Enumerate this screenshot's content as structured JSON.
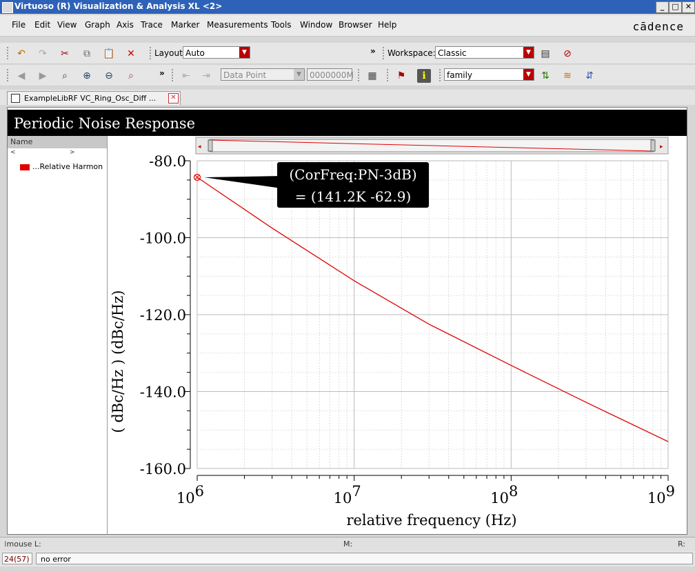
{
  "window": {
    "title": "Virtuoso (R) Visualization & Analysis XL <2>"
  },
  "menubar": {
    "items": [
      "File",
      "Edit",
      "View",
      "Graph",
      "Axis",
      "Trace",
      "Marker",
      "Measurements",
      "Tools",
      "Window",
      "Browser",
      "Help"
    ],
    "brand": "cādence"
  },
  "toolbar1": {
    "layout_label": "Layout:",
    "layout_value": "Auto",
    "workspace_label": "Workspace:",
    "workspace_value": "Classic",
    "overflow": "»"
  },
  "toolbar2": {
    "overflow": "»",
    "marker_type": "Data Point",
    "marker_value": "0000000M",
    "family_value": "family"
  },
  "tab": {
    "label": "ExampleLibRF VC_Ring_Osc_Diff ..."
  },
  "graph": {
    "title": "Periodic Noise Response"
  },
  "browser": {
    "header": "Name",
    "scroll_left": "<",
    "scroll_right": ">",
    "trace_label": "...Relative Harmon"
  },
  "marker": {
    "line1": "(CorFreq:PN-3dB)",
    "line2": "= (141.2K -62.9)"
  },
  "chart_data": {
    "type": "line",
    "xlabel": "relative frequency (Hz)",
    "ylabel": "( dBc/Hz ) (dBc/Hz)",
    "x_scale": "log",
    "xlim": [
      1000000,
      1000000000
    ],
    "ylim": [
      -160,
      -80
    ],
    "x_ticks": [
      {
        "value": 1000000,
        "base": "10",
        "exp": "6"
      },
      {
        "value": 10000000,
        "base": "10",
        "exp": "7"
      },
      {
        "value": 100000000,
        "base": "10",
        "exp": "8"
      },
      {
        "value": 1000000000,
        "base": "10",
        "exp": "9"
      }
    ],
    "y_ticks": [
      {
        "value": -80,
        "label": "-80.0"
      },
      {
        "value": -100,
        "label": "-100.0"
      },
      {
        "value": -120,
        "label": "-120.0"
      },
      {
        "value": -140,
        "label": "-140.0"
      },
      {
        "value": -160,
        "label": "-160.0"
      }
    ],
    "grid": true,
    "series": [
      {
        "color": "#e00000",
        "x": [
          1000000,
          3000000,
          10000000,
          30000000,
          100000000,
          300000000,
          1000000000
        ],
        "y": [
          -84.3,
          -97.5,
          -111.2,
          -122.5,
          -133.2,
          -142.8,
          -153.0
        ]
      }
    ],
    "marker_point": {
      "x": 1000000,
      "y": -84.3
    }
  }
}
